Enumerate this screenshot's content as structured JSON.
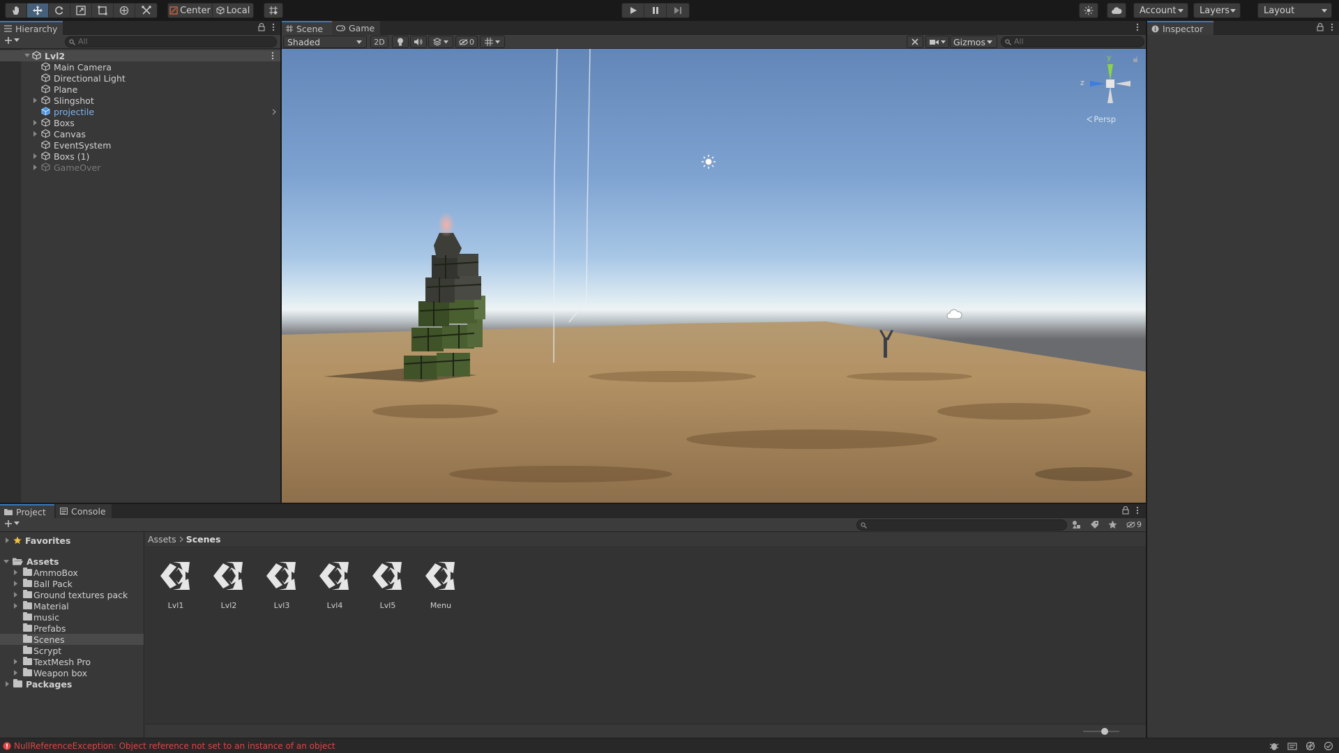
{
  "toolbar": {
    "tools": [
      "hand-tool",
      "move-tool",
      "rotate-tool",
      "scale-tool",
      "rect-tool",
      "transform-tool",
      "custom-tool"
    ],
    "pivot_label": "Center",
    "space_label": "Local",
    "account_label": "Account",
    "layers_label": "Layers",
    "layout_label": "Layout"
  },
  "hierarchy": {
    "tab_label": "Hierarchy",
    "search_placeholder": "All",
    "scene_name": "Lvl2",
    "items": [
      {
        "label": "Main Camera",
        "expandable": false,
        "selected": false,
        "disabled": false
      },
      {
        "label": "Directional Light",
        "expandable": false,
        "selected": false,
        "disabled": false
      },
      {
        "label": "Plane",
        "expandable": false,
        "selected": false,
        "disabled": false
      },
      {
        "label": "Slingshot",
        "expandable": true,
        "selected": false,
        "disabled": false
      },
      {
        "label": "projectile",
        "expandable": false,
        "selected": true,
        "disabled": false
      },
      {
        "label": "Boxs",
        "expandable": true,
        "selected": false,
        "disabled": false
      },
      {
        "label": "Canvas",
        "expandable": true,
        "selected": false,
        "disabled": false
      },
      {
        "label": "EventSystem",
        "expandable": false,
        "selected": false,
        "disabled": false
      },
      {
        "label": "Boxs (1)",
        "expandable": true,
        "selected": false,
        "disabled": false
      },
      {
        "label": "GameOver",
        "expandable": true,
        "selected": false,
        "disabled": true
      }
    ]
  },
  "scene_view": {
    "tabs": [
      "Scene",
      "Game"
    ],
    "draw_mode": "Shaded",
    "mode_2d": "2D",
    "hidden_count": "0",
    "gizmos_label": "Gizmos",
    "search_placeholder": "All",
    "axis_y": "y",
    "axis_z": "z",
    "projection_label": "Persp"
  },
  "inspector": {
    "tab_label": "Inspector"
  },
  "project": {
    "tabs": [
      "Project",
      "Console"
    ],
    "favorites_label": "Favorites",
    "assets_label": "Assets",
    "folders": [
      "AmmoBox",
      "Ball Pack",
      "Ground textures pack",
      "Material",
      "music",
      "Prefabs",
      "Scenes",
      "Scrypt",
      "TextMesh Pro",
      "Weapon box"
    ],
    "selected_folder": "Scenes",
    "packages_label": "Packages",
    "breadcrumb": [
      "Assets",
      "Scenes"
    ],
    "hidden_packages_count": "9",
    "scene_assets": [
      "Lvl1",
      "Lvl2",
      "Lvl3",
      "Lvl4",
      "Lvl5",
      "Menu"
    ]
  },
  "status_bar": {
    "error_message": "NullReferenceException: Object reference not set to an instance of an object"
  },
  "colors": {
    "accent": "#3a79bb",
    "selected_text": "#7bb5f5",
    "error": "#e04444"
  }
}
